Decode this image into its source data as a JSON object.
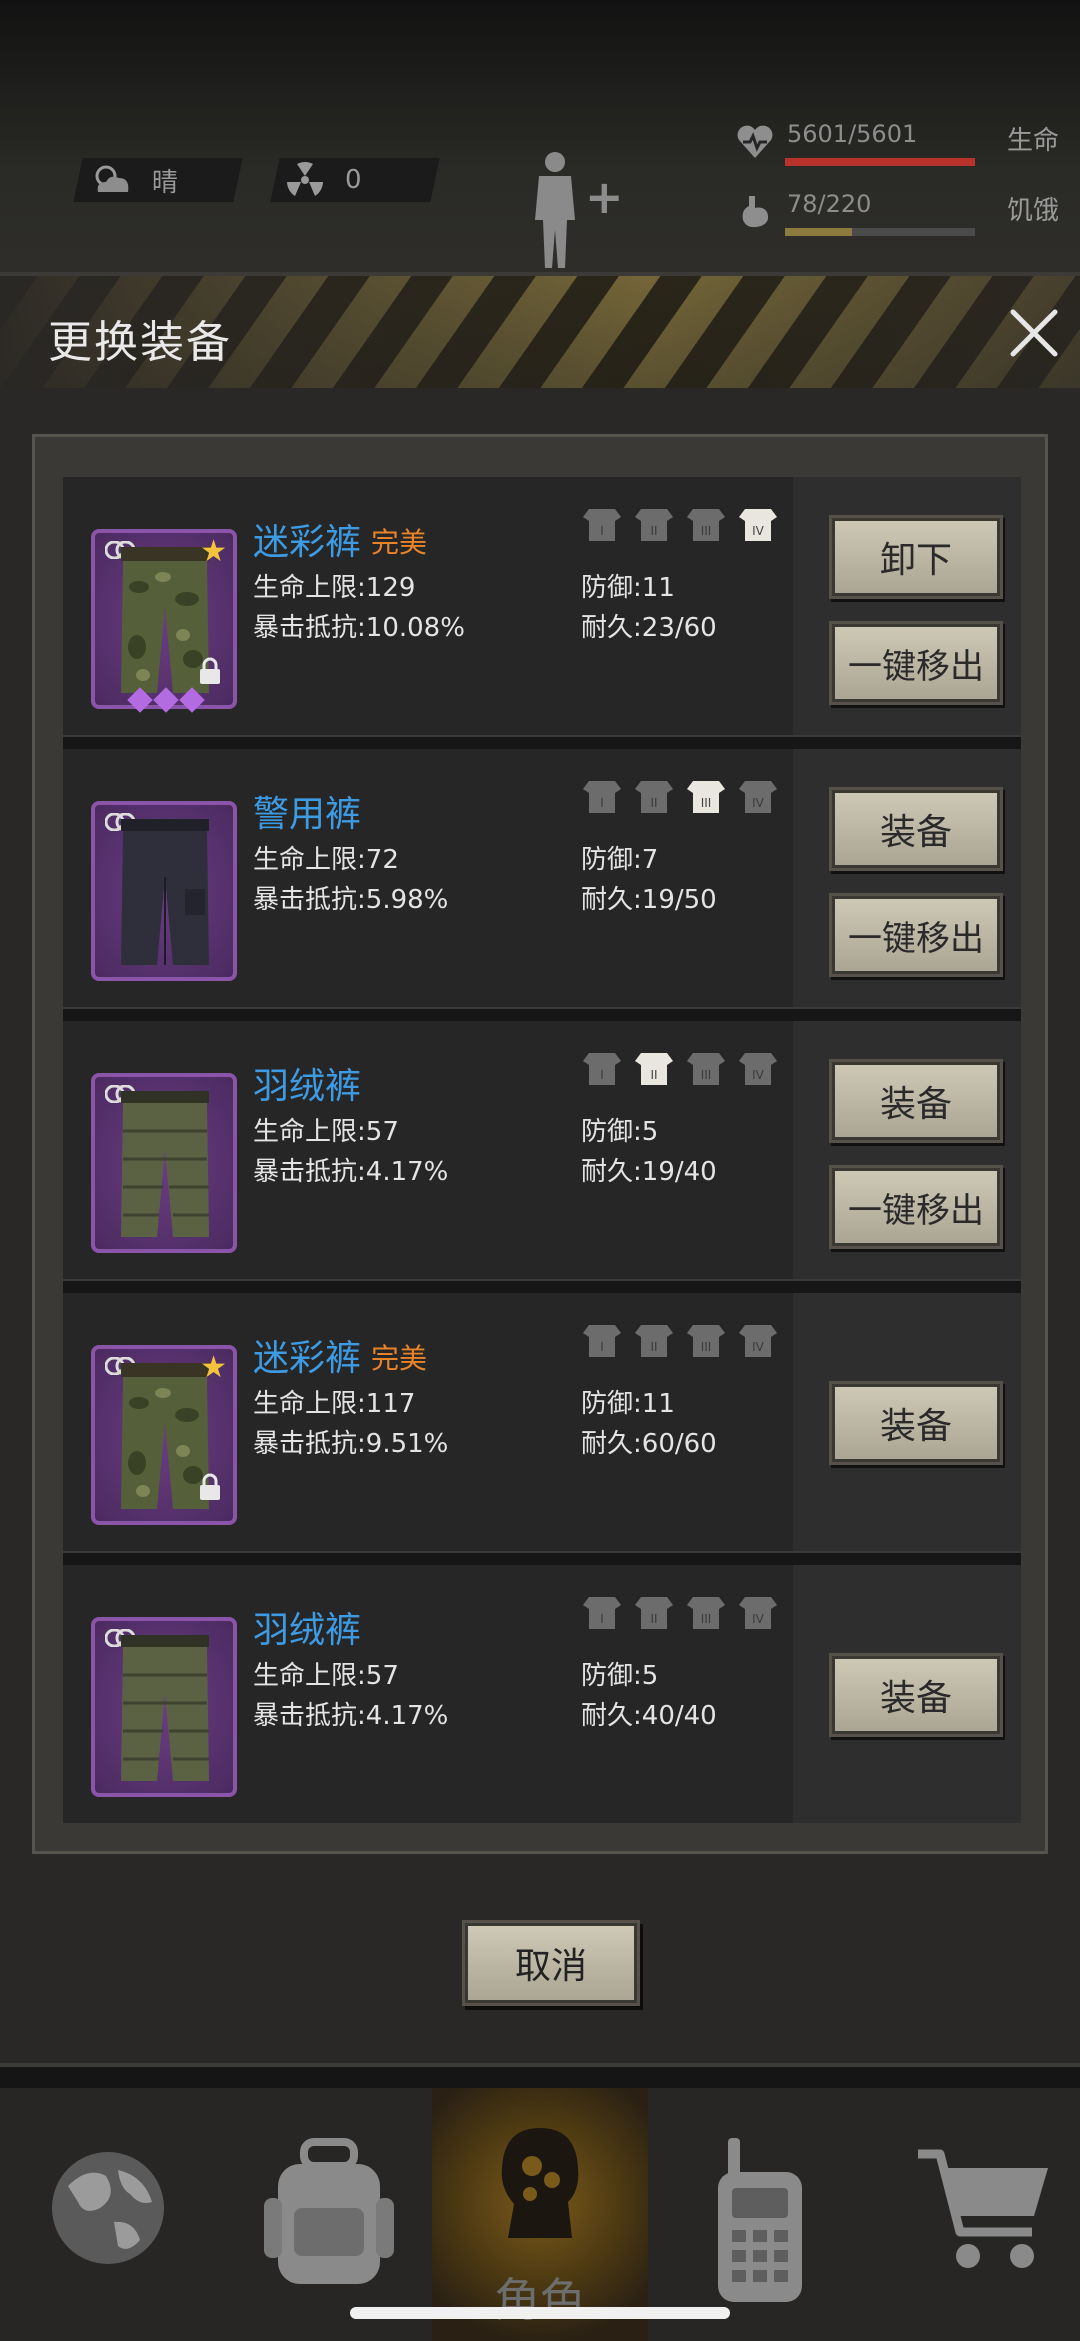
{
  "hud": {
    "weather_label": "晴",
    "radiation_value": "0",
    "health_value": "5601/5601",
    "health_label": "生命",
    "health_fraction": 1.0,
    "hunger_value": "78/220",
    "hunger_label": "饥饿",
    "hunger_fraction": 0.35
  },
  "dialog": {
    "title": "更换装备",
    "cancel_label": "取消"
  },
  "items": [
    {
      "name": "迷彩裤",
      "quality": "完美",
      "hp_label": "生命上限",
      "hp": "129",
      "crit_label": "暴击抵抗",
      "crit": "10.08%",
      "def_label": "防御",
      "def": "11",
      "dur_label": "耐久",
      "dur": "23/60",
      "tier_active": 4,
      "starred": true,
      "locked": true,
      "gems": 3,
      "pants": "camo",
      "primary_label": "卸下",
      "secondary_label": "一键移出"
    },
    {
      "name": "警用裤",
      "quality": "",
      "hp_label": "生命上限",
      "hp": "72",
      "crit_label": "暴击抵抗",
      "crit": "5.98%",
      "def_label": "防御",
      "def": "7",
      "dur_label": "耐久",
      "dur": "19/50",
      "tier_active": 3,
      "starred": false,
      "locked": false,
      "gems": 0,
      "pants": "police",
      "primary_label": "装备",
      "secondary_label": "一键移出"
    },
    {
      "name": "羽绒裤",
      "quality": "",
      "hp_label": "生命上限",
      "hp": "57",
      "crit_label": "暴击抵抗",
      "crit": "4.17%",
      "def_label": "防御",
      "def": "5",
      "dur_label": "耐久",
      "dur": "19/40",
      "tier_active": 2,
      "starred": false,
      "locked": false,
      "gems": 0,
      "pants": "down",
      "primary_label": "装备",
      "secondary_label": "一键移出"
    },
    {
      "name": "迷彩裤",
      "quality": "完美",
      "hp_label": "生命上限",
      "hp": "117",
      "crit_label": "暴击抵抗",
      "crit": "9.51%",
      "def_label": "防御",
      "def": "11",
      "dur_label": "耐久",
      "dur": "60/60",
      "tier_active": 0,
      "starred": true,
      "locked": true,
      "gems": 0,
      "pants": "camo",
      "primary_label": "装备",
      "secondary_label": ""
    },
    {
      "name": "羽绒裤",
      "quality": "",
      "hp_label": "生命上限",
      "hp": "57",
      "crit_label": "暴击抵抗",
      "crit": "4.17%",
      "def_label": "防御",
      "def": "5",
      "dur_label": "耐久",
      "dur": "40/40",
      "tier_active": 0,
      "starred": false,
      "locked": false,
      "gems": 0,
      "pants": "down",
      "primary_label": "装备",
      "secondary_label": ""
    }
  ],
  "nav": {
    "active_label": "角色",
    "tabs": [
      "globe-icon",
      "backpack-icon",
      "character-icon",
      "radio-icon",
      "cart-icon"
    ]
  },
  "colors": {
    "name_blue": "#3d9be4",
    "quality_orange": "#e8832a",
    "health_red": "#b8322c",
    "hunger_gold": "#8c7a3e",
    "rarity_purple": "#8a54a8"
  }
}
